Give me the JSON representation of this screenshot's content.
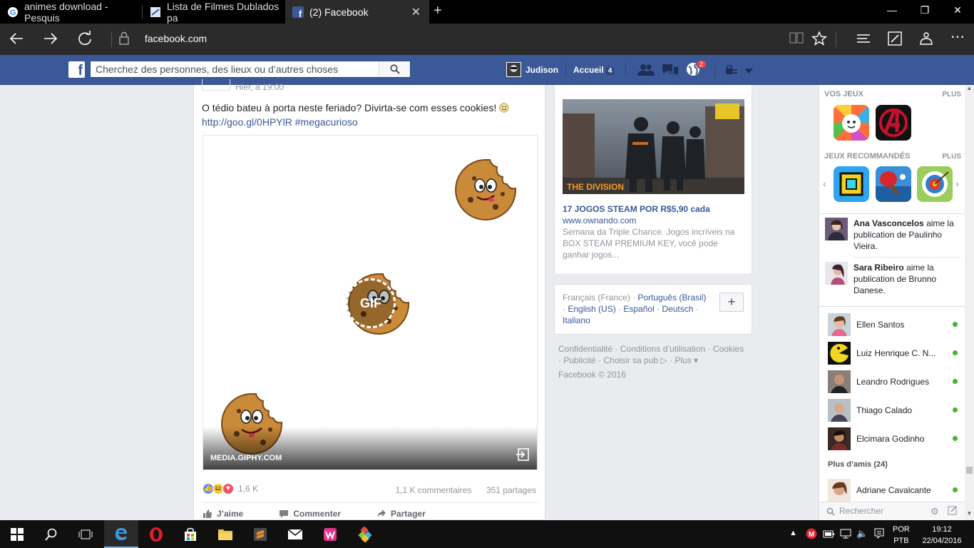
{
  "browser": {
    "tabs": [
      {
        "title": "animes download - Pesquis",
        "icon": "google-icon"
      },
      {
        "title": "Lista de Filmes Dublados pa",
        "icon": "site-icon"
      },
      {
        "title": "(2) Facebook",
        "icon": "facebook-icon"
      }
    ],
    "url": "facebook.com"
  },
  "fb": {
    "search_placeholder": "Cherchez des personnes, des lieux ou d’autres choses",
    "user_name": "Judison",
    "home_label": "Accueil",
    "home_count": "4",
    "notifications_count": "2"
  },
  "post": {
    "meta": "Hier, à 19:00",
    "text": "O tédio bateu à porta neste feriado? Divirta-se com esses cookies!",
    "link": "http://goo.gl/0HPYlR",
    "hashtag": "#megacurioso",
    "media_source": "MEDIA.GIPHY.COM",
    "gif_label": "GIF",
    "reactions_count": "1,6 K",
    "comments": "1,1 K commentaires",
    "shares": "351 partages",
    "actions": {
      "like": "J’aime",
      "comment": "Commenter",
      "share": "Partager"
    }
  },
  "ad": {
    "image_text": "THE DIVISION",
    "title": "17 JOGOS STEAM POR R$5,90 cada",
    "url": "www.ownando.com",
    "description": "Semana da Triple Chance. Jogos incríveis na BOX STEAM PREMIUM KEY, você pode ganhar jogos..."
  },
  "languages": {
    "current": "Français (France)",
    "others": [
      "Português (Brasil)",
      "English (US)",
      "Español",
      "Deutsch",
      "Italiano"
    ]
  },
  "footer": {
    "links": [
      "Confidentialité",
      "Conditions d’utilisation",
      "Cookies",
      "Publicité",
      "Choisir sa pub",
      "Plus"
    ],
    "copyright": "Facebook © 2016"
  },
  "sidebar": {
    "your_games": "VOS JEUX",
    "recommended": "JEUX RECOMMANDÉS",
    "plus": "PLUS",
    "ticker": [
      {
        "name": "Ana Vasconcelos",
        "text": "aime la publication de Paulinho Vieira."
      },
      {
        "name": "Sara Ribeiro",
        "text": "aime la publication de Brunno Danese."
      }
    ],
    "chat": [
      "Ellen Santos",
      "Luiz Henrique C. N...",
      "Leandro Rodrigues",
      "Thiago Calado",
      "Elcimara Godinho"
    ],
    "more_friends": "Plus d’amis (24)",
    "chat_extra": "Adriane Cavalcante",
    "chat_search_placeholder": "Rechercher"
  },
  "taskbar": {
    "lang1": "POR",
    "lang2": "PTB",
    "time": "19:12",
    "date": "22/04/2016"
  }
}
